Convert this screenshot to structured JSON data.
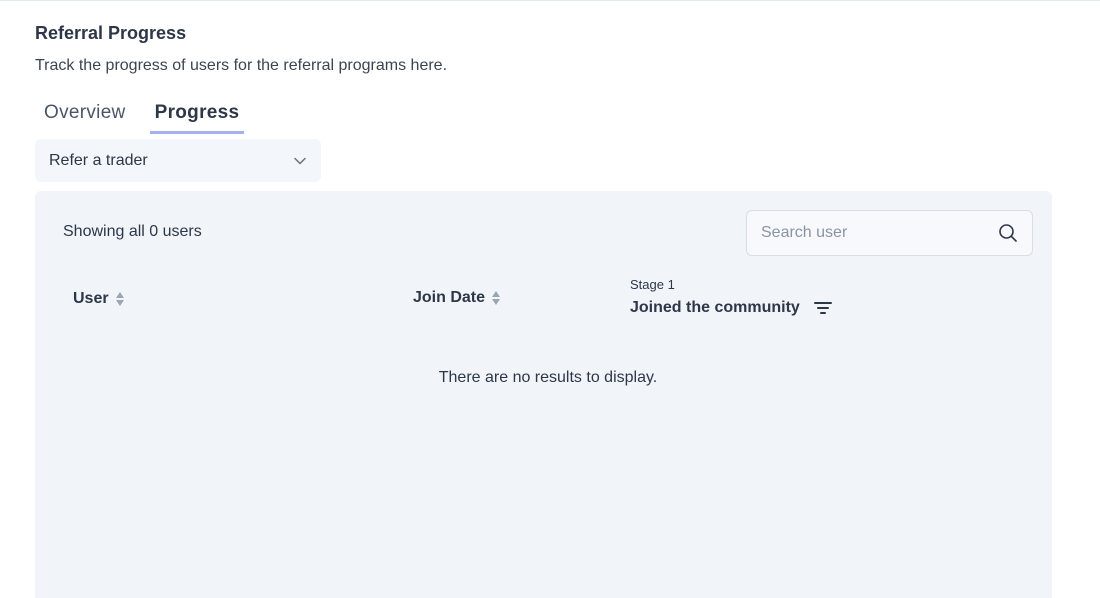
{
  "header": {
    "title": "Referral Progress",
    "subtitle": "Track the progress of users for the referral programs here."
  },
  "tabs": [
    {
      "label": "Overview",
      "active": false
    },
    {
      "label": "Progress",
      "active": true
    }
  ],
  "program_select": {
    "value": "Refer a trader",
    "icon": "chevron-down-icon"
  },
  "table": {
    "count_text": "Showing all 0 users",
    "search": {
      "placeholder": "Search user",
      "value": "",
      "icon": "search-icon"
    },
    "columns": {
      "user": "User",
      "join_date": "Join Date",
      "stage_label": "Stage 1",
      "stage_name": "Joined the community"
    },
    "rows": [],
    "empty_message": "There are no results to display."
  },
  "colors": {
    "accent_underline": "#a5b0f0",
    "panel_bg": "#f1f5f9",
    "text": "#2d3748"
  }
}
